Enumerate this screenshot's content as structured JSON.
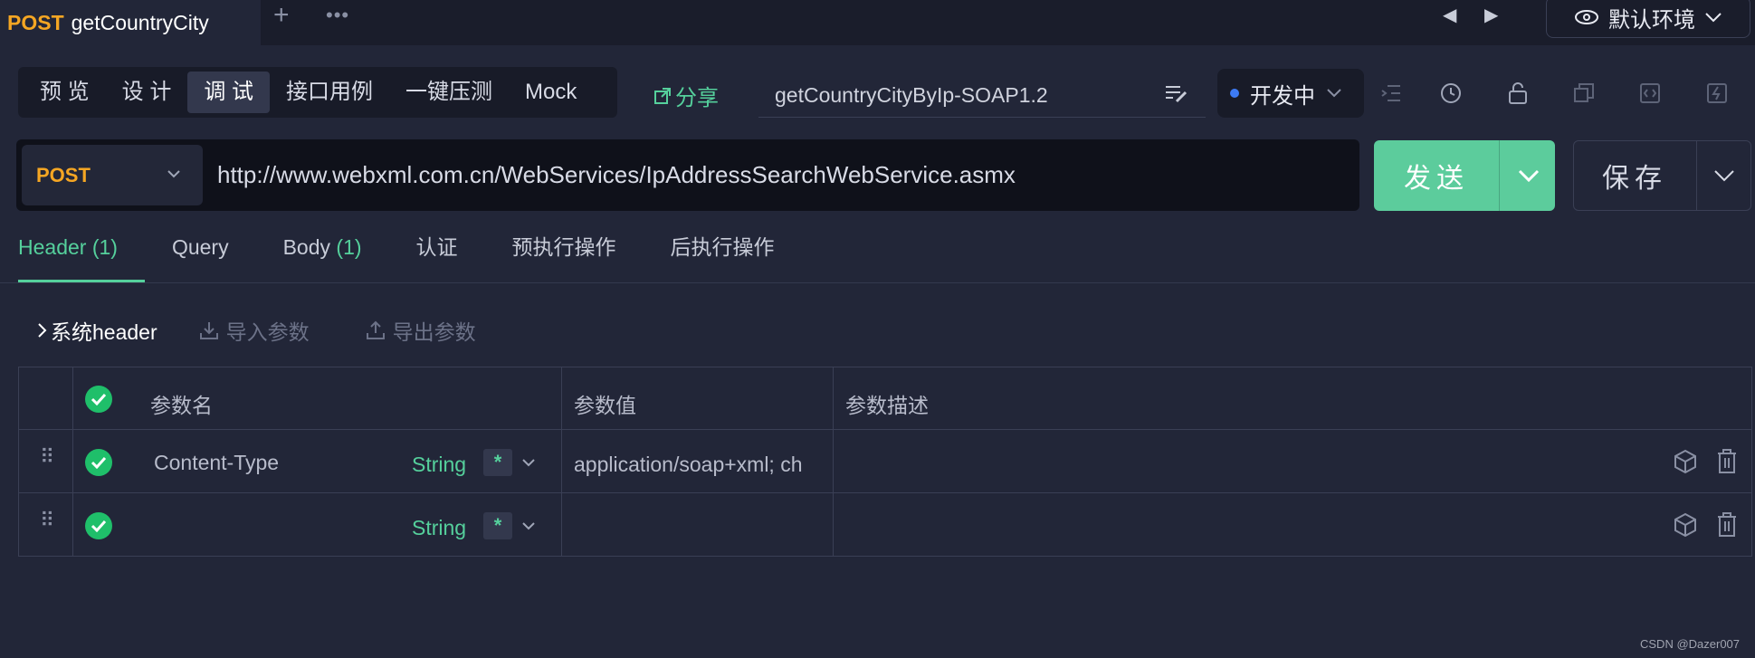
{
  "top_tab": {
    "method": "POST",
    "name": "getCountryCity"
  },
  "environment": {
    "label": "默认环境"
  },
  "mode_tabs": [
    {
      "label": "预 览"
    },
    {
      "label": "设 计"
    },
    {
      "label": "调 试"
    },
    {
      "label": "接口用例"
    },
    {
      "label": "一键压测"
    },
    {
      "label": "Mock"
    }
  ],
  "active_mode_tab": "调 试",
  "share_label": "分享",
  "doc_name": "getCountryCityByIp-SOAP1.2",
  "status_label": "开发中",
  "request": {
    "method": "POST",
    "url": "http://www.webxml.com.cn/WebServices/IpAddressSearchWebService.asmx",
    "send_label": "发送",
    "save_label": "保存"
  },
  "request_tabs": [
    {
      "label": "Header",
      "count": "(1)"
    },
    {
      "label": "Query",
      "count": ""
    },
    {
      "label": "Body",
      "count": "(1)"
    },
    {
      "label": "认证",
      "count": ""
    },
    {
      "label": "预执行操作",
      "count": ""
    },
    {
      "label": "后执行操作",
      "count": ""
    }
  ],
  "toolbar": {
    "system_header": "系统header",
    "import": "导入参数",
    "export": "导出参数"
  },
  "table": {
    "headers": {
      "name": "参数名",
      "value": "参数值",
      "desc": "参数描述"
    },
    "rows": [
      {
        "name": "Content-Type",
        "type": "String",
        "required": "*",
        "value": "application/soap+xml; ch",
        "desc": ""
      },
      {
        "name": "",
        "type": "String",
        "required": "*",
        "value": "",
        "desc": ""
      }
    ]
  },
  "watermark": "CSDN @Dazer007"
}
